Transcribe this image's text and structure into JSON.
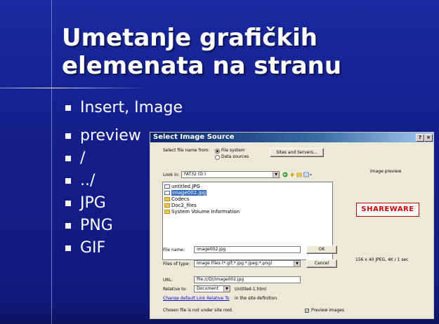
{
  "slide": {
    "title_lines": [
      "Umetanje grafičkih",
      "elemenata na stranu"
    ],
    "bullets": [
      "Insert, Image",
      "preview",
      "/",
      "../",
      "JPG",
      "PNG",
      "GIF"
    ]
  },
  "dialog": {
    "title": "Select Image Source",
    "help_button": "?",
    "close_button": "×",
    "select_from_label": "Select file name from:",
    "radio_file_system": "File system",
    "radio_data_sources": "Data sources",
    "sites_servers_button": "Sites and Servers...",
    "look_in_label": "Look in:",
    "look_in_value": "FAT32 (D:)",
    "files": [
      {
        "name": "untitled.JPG",
        "type": "image",
        "selected": false
      },
      {
        "name": "image002.jpg",
        "type": "image",
        "selected": true
      },
      {
        "name": "Codecs",
        "type": "folder",
        "selected": false
      },
      {
        "name": "Doc2_files",
        "type": "folder",
        "selected": false
      },
      {
        "name": "System Volume Information",
        "type": "folder",
        "selected": false
      }
    ],
    "file_name_label": "File name:",
    "file_name_value": "image002.jpg",
    "ok_button": "OK",
    "files_of_type_label": "Files of type:",
    "files_of_type_value": "Image Files (*.gif;*.jpg;*.jpeg;*.png)",
    "cancel_button": "Cancel",
    "url_label": "URL:",
    "url_value": "file:///D|/image002.jpg",
    "relative_to_label": "Relative to:",
    "relative_to_value": "Document",
    "relative_to_file": "Untitled-1.html",
    "change_link": "Change default Link Relative To",
    "change_link_suffix": "in the site definition.",
    "site_root_note": "Chosen file is not under site root.",
    "preview_checkbox": "Preview images",
    "preview_checked": true,
    "image_preview_label": "Image preview",
    "preview_logo": "SHAREWARE",
    "preview_info": "156 x 40 JPEG, 4K / 1 sec"
  }
}
